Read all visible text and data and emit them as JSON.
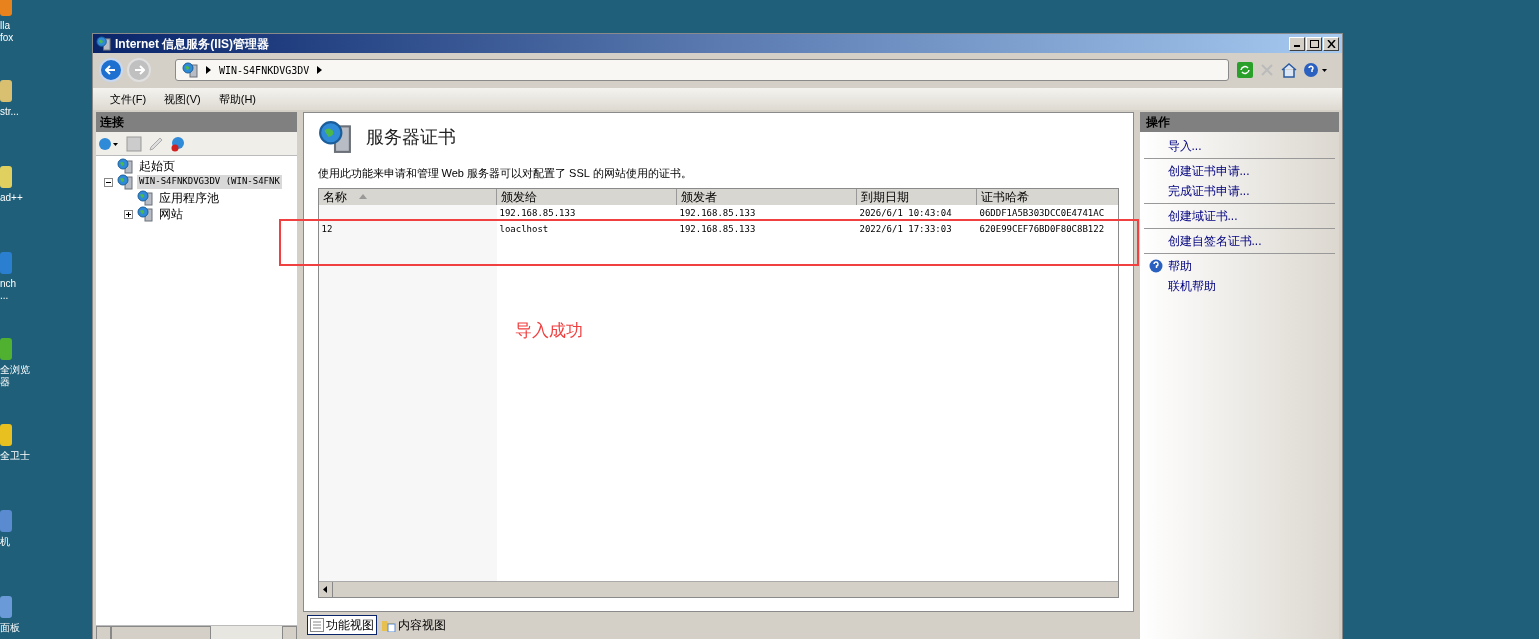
{
  "desktop_icons": [
    {
      "label": "lla\nfox"
    },
    {
      "label": "str..."
    },
    {
      "label": "ad++"
    },
    {
      "label": "nch\n..."
    },
    {
      "label": "全浏览器"
    },
    {
      "label": "全卫士"
    },
    {
      "label": "机"
    },
    {
      "label": "面板"
    }
  ],
  "window": {
    "title": "Internet 信息服务(IIS)管理器"
  },
  "address_bar": {
    "path": [
      "WIN-S4FNKDVG3DV"
    ]
  },
  "menu": [
    "文件(F)",
    "视图(V)",
    "帮助(H)"
  ],
  "connections": {
    "title": "连接",
    "tree": [
      {
        "label": "起始页",
        "selected": false
      },
      {
        "label": "WIN-S4FNKDVG3DV (WIN-S4FNK",
        "selected": true,
        "expanded": true,
        "children": [
          {
            "label": "应用程序池",
            "selected": false
          },
          {
            "label": "网站",
            "selected": false,
            "expanded": false
          }
        ]
      }
    ]
  },
  "feature": {
    "title": "服务器证书",
    "description": "使用此功能来申请和管理 Web 服务器可以对配置了 SSL 的网站使用的证书。",
    "table": {
      "columns": [
        "名称",
        "颁发给",
        "颁发者",
        "到期日期",
        "证书哈希"
      ],
      "rows": [
        [
          "",
          "192.168.85.133",
          "192.168.85.133",
          "2026/6/1 10:43:04",
          "06DDF1A5B303DCC0E4741AC"
        ],
        [
          "12",
          "loaclhost",
          "192.168.85.133",
          "2022/6/1 17:33:03",
          "620E99CEF76BD0F80C8B122"
        ]
      ]
    }
  },
  "view_tabs": [
    {
      "label": "功能视图",
      "selected": true
    },
    {
      "label": "内容视图",
      "selected": false
    }
  ],
  "actions": {
    "title": "操作",
    "groups": [
      [
        {
          "label": "导入..."
        }
      ],
      [
        {
          "label": "创建证书申请..."
        },
        {
          "label": "完成证书申请..."
        }
      ],
      [
        {
          "label": "创建域证书..."
        }
      ],
      [
        {
          "label": "创建自签名证书..."
        }
      ],
      [
        {
          "label": "帮助",
          "kind": "help"
        },
        {
          "label": "联机帮助"
        }
      ]
    ]
  },
  "annotation": {
    "text": "导入成功"
  }
}
